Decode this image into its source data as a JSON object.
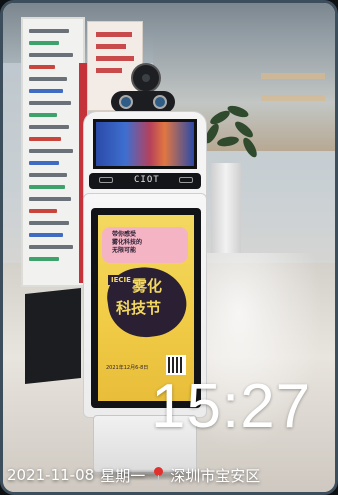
{
  "photo": {
    "kiosk": {
      "brand": "CIOT",
      "ad": {
        "tag": "IECIE",
        "title_line1": "雾化",
        "title_line2": "科技节",
        "subtitle_lines": [
          "带你感受",
          "雾化科技的",
          "无限可能"
        ],
        "date_text": "2021年12月6-8日"
      }
    }
  },
  "overlay": {
    "time": "15:27",
    "date": "2021-11-08",
    "weekday": "星期一",
    "location": "深圳市宝安区",
    "location_icon": "map-pin-icon",
    "text_color": "#ffffff"
  }
}
